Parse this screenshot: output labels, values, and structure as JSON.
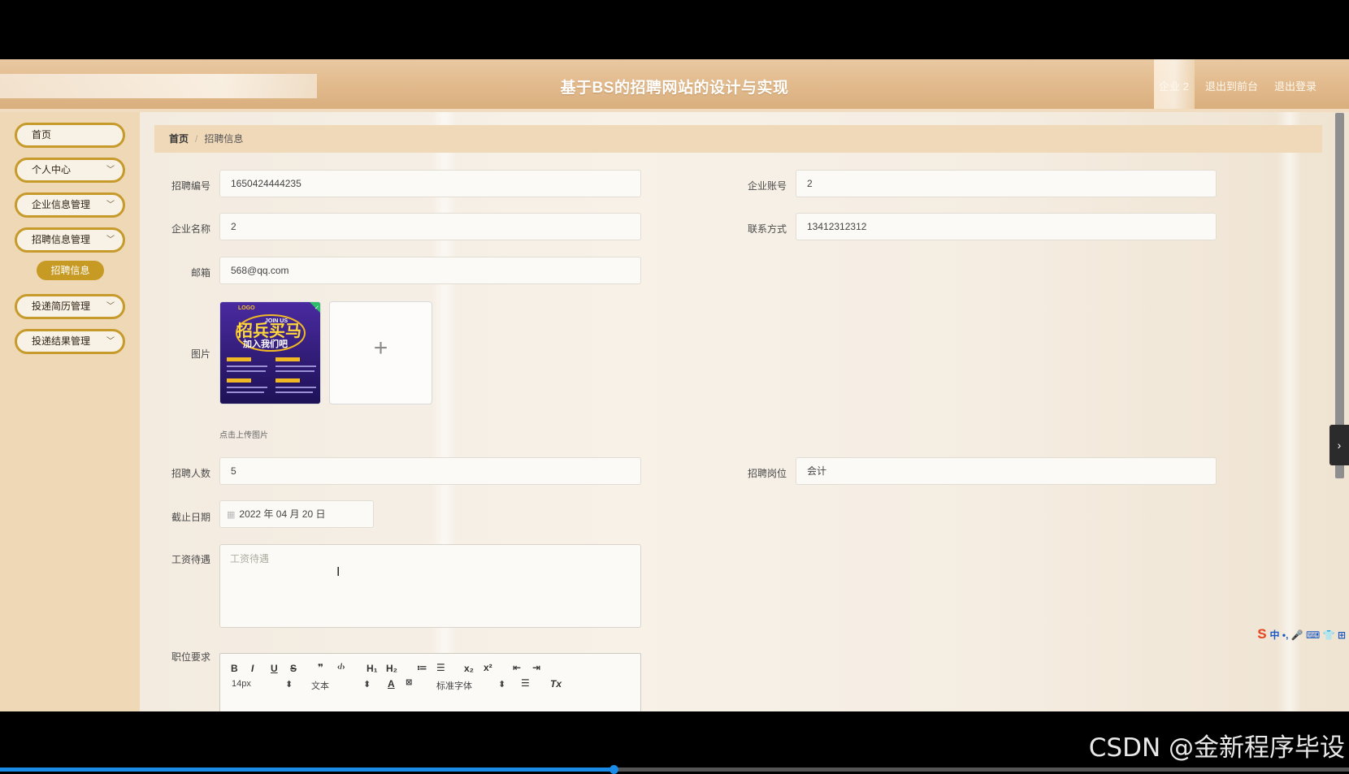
{
  "header": {
    "title": "基于BS的招聘网站的设计与实现",
    "user": "企业 2",
    "back_front": "退出到前台",
    "logout": "退出登录"
  },
  "sidebar": {
    "items": [
      {
        "label": "首页",
        "chevron": false
      },
      {
        "label": "个人中心",
        "chevron": true
      },
      {
        "label": "企业信息管理",
        "chevron": true
      },
      {
        "label": "招聘信息管理",
        "chevron": true
      },
      {
        "label": "投递简历管理",
        "chevron": true
      },
      {
        "label": "投递结果管理",
        "chevron": true
      }
    ],
    "active_sub": "招聘信息"
  },
  "breadcrumb": {
    "home": "首页",
    "sep": "/",
    "current": "招聘信息"
  },
  "form": {
    "recruit_no_label": "招聘编号",
    "recruit_no": "1650424444235",
    "company_account_label": "企业账号",
    "company_account": "2",
    "company_name_label": "企业名称",
    "company_name": "2",
    "contact_label": "联系方式",
    "contact": "13412312312",
    "email_label": "邮箱",
    "email": "568@qq.com",
    "image_label": "图片",
    "upload_tip": "点击上传图片",
    "upload_plus": "+",
    "headcount_label": "招聘人数",
    "headcount": "5",
    "position_label": "招聘岗位",
    "position": "会计",
    "deadline_label": "截止日期",
    "deadline": "2022 年 04 月 20 日",
    "salary_label": "工资待遇",
    "salary_placeholder": "工资待遇",
    "requirement_label": "职位要求"
  },
  "poster": {
    "logo": "LOGO",
    "join": "JOIN US",
    "headline": "招兵买马",
    "subline": "加入我们吧"
  },
  "editor": {
    "row1": [
      "B",
      "I",
      "U",
      "S",
      "❞",
      "‹/›",
      "H₁",
      "H₂",
      "≔",
      "☰",
      "x₂",
      "x²",
      "⇤",
      "⇥"
    ],
    "font_size": "14px",
    "block": "文本",
    "font_family": "标准字体",
    "clear": "Tx"
  },
  "ime": {
    "s": "S",
    "text": "中 •, 🎤 ⌨ 👕 ⊞"
  },
  "watermark": "CSDN @金新程序毕设",
  "video_progress": 0.455,
  "colors": {
    "accent": "#c79a24",
    "header": "#e2bb8e",
    "sidebar": "#efd8b5"
  }
}
